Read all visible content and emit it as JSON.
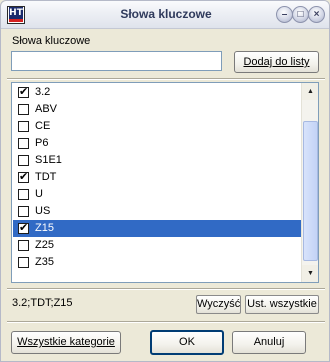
{
  "window": {
    "title": "Słowa kluczowe",
    "app_icon_text": "HT",
    "controls": [
      "minimize-icon",
      "maximize-icon",
      "close-icon"
    ]
  },
  "keyword_field": {
    "label": "Słowa kluczowe",
    "value": "",
    "add_button": "Dodaj do listy"
  },
  "list": {
    "items": [
      {
        "label": "3.2",
        "checked": true,
        "selected": false
      },
      {
        "label": "ABV",
        "checked": false,
        "selected": false
      },
      {
        "label": "CE",
        "checked": false,
        "selected": false
      },
      {
        "label": "P6",
        "checked": false,
        "selected": false
      },
      {
        "label": "S1E1",
        "checked": false,
        "selected": false
      },
      {
        "label": "TDT",
        "checked": true,
        "selected": false
      },
      {
        "label": "U",
        "checked": false,
        "selected": false
      },
      {
        "label": "US",
        "checked": false,
        "selected": false
      },
      {
        "label": "Z15",
        "checked": true,
        "selected": true
      },
      {
        "label": "Z25",
        "checked": false,
        "selected": false
      },
      {
        "label": "Z35",
        "checked": false,
        "selected": false
      }
    ]
  },
  "summary": {
    "text": "3.2;TDT;Z15",
    "clear_button": "Wyczyść",
    "select_all_button": "Ust. wszystkie"
  },
  "footer": {
    "all_categories_button": "Wszystkie kategorie",
    "ok_button": "OK",
    "cancel_button": "Anuluj"
  },
  "colors": {
    "selection": "#316ac5",
    "window_bg": "#ece9d8",
    "field_border": "#7f9db9"
  }
}
